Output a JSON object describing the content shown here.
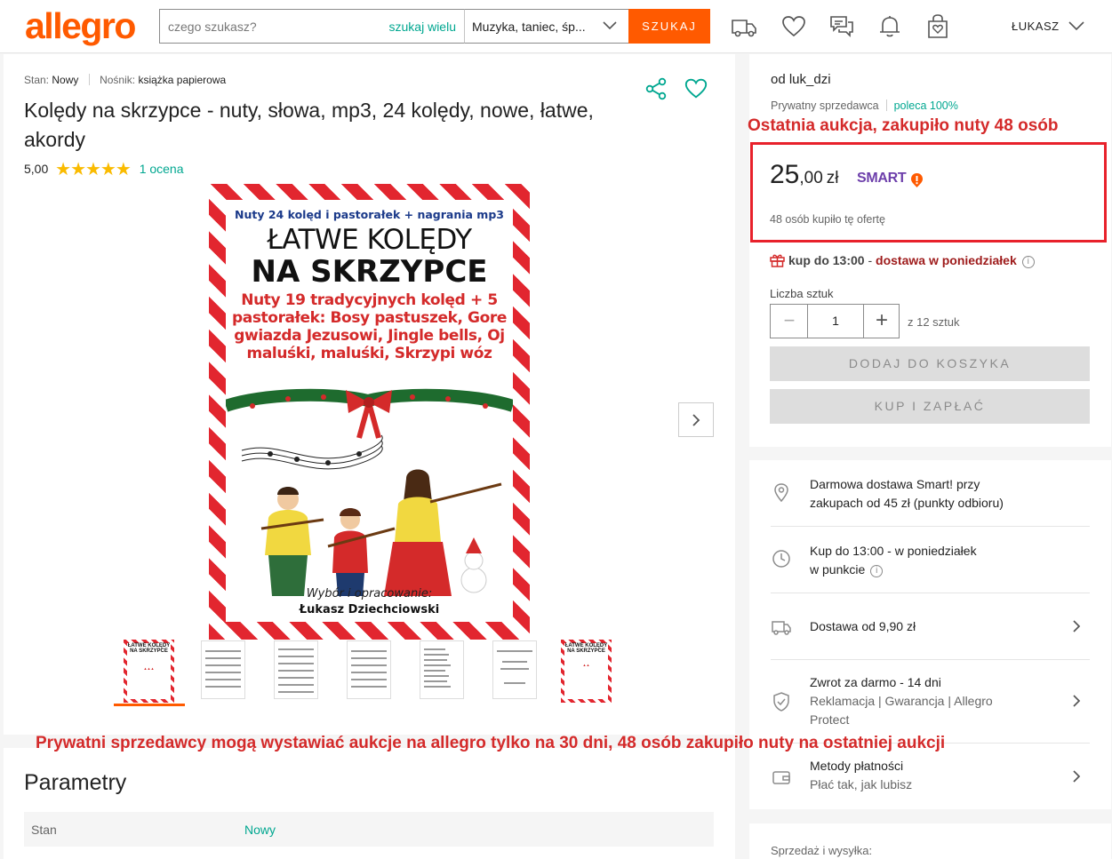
{
  "header": {
    "logo": "allegro",
    "search_placeholder": "czego szukasz?",
    "search_many": "szukaj wielu",
    "category": "Muzyka, taniec, śp...",
    "search_button": "SZUKAJ",
    "user": "ŁUKASZ",
    "icons": [
      "delivery-truck-icon",
      "heart-icon",
      "chat-icon",
      "bell-icon",
      "cart-bag-icon"
    ]
  },
  "product": {
    "condition_label": "Stan:",
    "condition": "Nowy",
    "medium_label": "Nośnik:",
    "medium": "książka papierowa",
    "title": "Kolędy na skrzypce - nuty, słowa, mp3, 24 kolędy, nowe, łatwe, akordy",
    "rating": "5,00",
    "rating_value": 5,
    "rating_count": "1 ocena"
  },
  "cover": {
    "line1": "Nuty 24 kolęd i pastorałek +  nagrania mp3",
    "line2": "ŁATWE KOLĘDY",
    "line3": "NA SKRZYPCE",
    "line4": "Nuty 19 tradycyjnych kolęd + 5 pastorałek: Bosy pastuszek, Gore gwiazda Jezusowi, Jingle bells, Oj maluśki, maluśki, Skrzypi wóz",
    "footer1": "Wybór i opracowanie:",
    "footer2": "Łukasz Dziechciowski",
    "thumb_l1": "ŁATWE KOLĘDY",
    "thumb_l2": "NA SKRZYPCE"
  },
  "gallery": {
    "thumbnail_count": 7,
    "active_index": 0
  },
  "annotations": {
    "note_top": "Ostatnia aukcja, zakupiło nuty 48 osób",
    "note_bottom": "Prywatni sprzedawcy mogą wystawiać aukcje na allegro tylko na 30 dni,  48 osób zakupiło nuty na ostatniej aukcji"
  },
  "seller": {
    "name": "od luk_dzi",
    "type": "Prywatny sprzedawca",
    "recommend": "poleca 100%"
  },
  "offer": {
    "price_int": "25",
    "price_dec": ",00",
    "currency": "zł",
    "smart": "SMART",
    "bought": "48 osób kupiło tę ofertę",
    "delivery_when": "kup do 13:00",
    "delivery_dash": " - ",
    "delivery_day": "dostawa w poniedziałek",
    "qty_label": "Liczba sztuk",
    "qty_value": "1",
    "qty_of": "z 12 sztuk",
    "add_to_cart": "DODAJ DO KOSZYKA",
    "buy_now": "KUP I ZAPŁAĆ"
  },
  "info": [
    {
      "icon": "location-pin-icon",
      "line1": "Darmowa dostawa Smart! przy",
      "line2": "zakupach od 45 zł (punkty odbioru)"
    },
    {
      "icon": "clock-icon",
      "line1": "Kup do 13:00 - w poniedziałek",
      "line2": "w punkcie"
    },
    {
      "icon": "truck-icon",
      "line1": "Dostawa od 9,90 zł"
    },
    {
      "icon": "shield-check-icon",
      "line1": "Zwrot za darmo - 14 dni",
      "line2": "Reklamacja | Gwarancja | Allegro",
      "line3": "Protect"
    },
    {
      "icon": "wallet-icon",
      "line1": "Metody płatności",
      "line2": "Płać tak, jak lubisz"
    }
  ],
  "params": {
    "title": "Parametry",
    "rows": [
      {
        "key": "Stan",
        "value": "Nowy"
      }
    ]
  },
  "sales": {
    "label": "Sprzedaż i wysyłka:"
  },
  "colors": {
    "brand": "#ff5a00",
    "link": "#00a790",
    "annotation_red": "#d42a2a",
    "smart_purple": "#6d3fab",
    "star": "#fabb00"
  }
}
